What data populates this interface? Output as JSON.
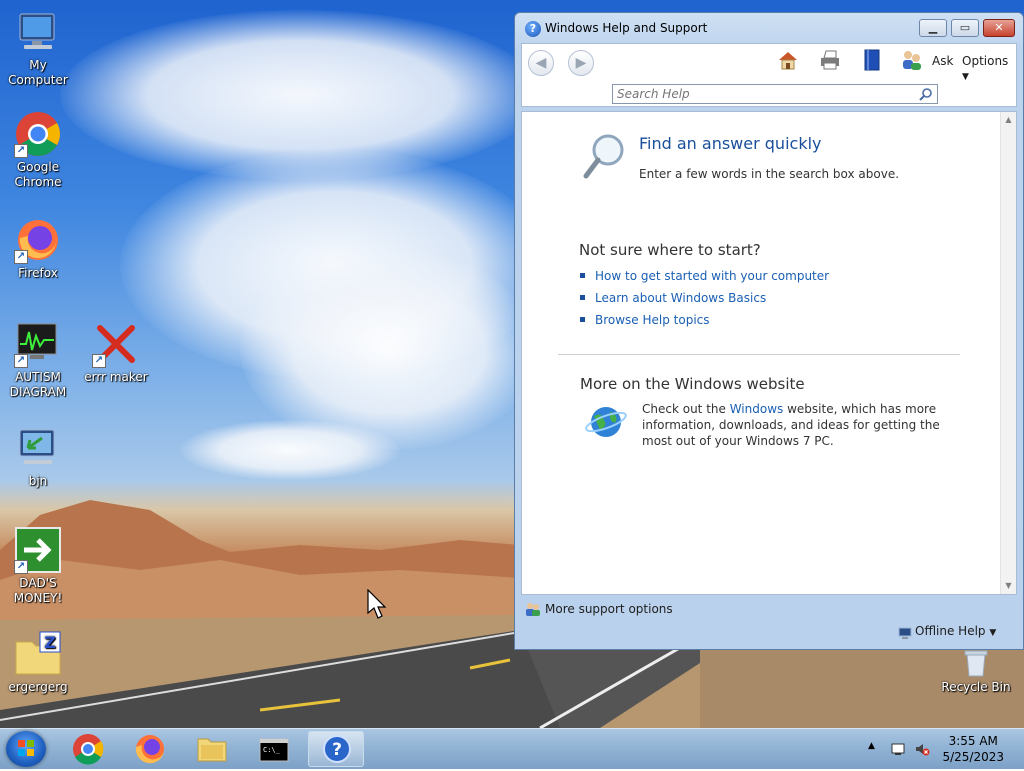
{
  "desktop": {
    "icons": [
      {
        "label": "My Computer"
      },
      {
        "label": "Google Chrome"
      },
      {
        "label": "Firefox"
      },
      {
        "label": "AUTISM DIAGRAM"
      },
      {
        "label": "errr maker"
      },
      {
        "label": "bjn"
      },
      {
        "label": "DAD'S MONEY!"
      },
      {
        "label": "ergergerg"
      },
      {
        "label": "Recycle Bin"
      }
    ]
  },
  "help_window": {
    "title": "Windows Help and Support",
    "toolbar": {
      "back_icon": "back-arrow-icon",
      "forward_icon": "forward-arrow-icon",
      "home_icon": "home-icon",
      "print_icon": "printer-icon",
      "browse_icon": "book-icon",
      "ask_icon": "people-icon",
      "ask_label": "Ask",
      "options_label": "Options"
    },
    "search": {
      "placeholder": "Search Help",
      "value": ""
    },
    "content": {
      "find_heading": "Find an answer quickly",
      "find_text": "Enter a few words in the search box above.",
      "start_heading": "Not sure where to start?",
      "start_links": [
        "How to get started with your computer",
        "Learn about Windows Basics",
        "Browse Help topics"
      ],
      "web_heading": "More on the Windows website",
      "web_text_before": "Check out the ",
      "web_link": "Windows",
      "web_text_after": " website, which has more information, downloads, and ideas for getting the most out of your Windows 7 PC."
    },
    "footer": {
      "more_support": "More support options",
      "offline_help": "Offline Help"
    }
  },
  "taskbar": {
    "items": [
      "Google Chrome",
      "Firefox",
      "Windows Explorer",
      "Command Prompt",
      "Windows Help and Support"
    ],
    "clock_time": "3:55 AM",
    "clock_date": "5/25/2023"
  }
}
